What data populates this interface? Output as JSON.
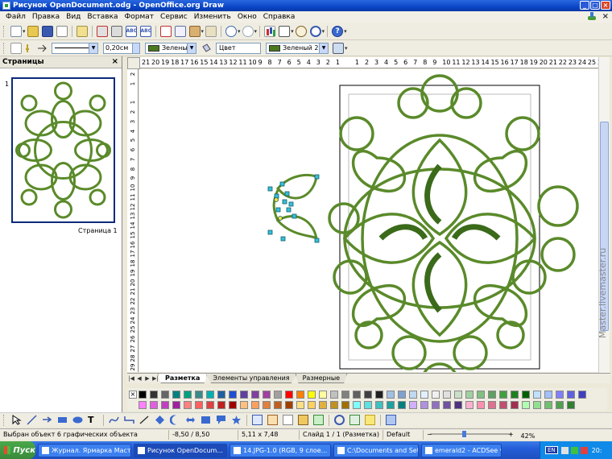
{
  "window": {
    "title": "Рисунок OpenDocument.odg - OpenOffice.org Draw"
  },
  "menu": [
    "Файл",
    "Правка",
    "Вид",
    "Вставка",
    "Формат",
    "Сервис",
    "Изменить",
    "Окно",
    "Справка"
  ],
  "toolbar2": {
    "line_width": "0,20см",
    "line_color": "Зеленый",
    "area_style": "Цвет",
    "area_color": "Зеленый 2",
    "color_hex": "#4a7a1e"
  },
  "pages_panel": {
    "title": "Страницы",
    "page_number": "1",
    "page_label": "Страница 1"
  },
  "rulers": {
    "horizontal": [
      "21",
      "20",
      "19",
      "18",
      "17",
      "16",
      "15",
      "14",
      "13",
      "12",
      "11",
      "10",
      "9",
      "8",
      "7",
      "6",
      "5",
      "4",
      "3",
      "2",
      "1",
      "",
      "1",
      "2",
      "3",
      "4",
      "5",
      "6",
      "7",
      "8",
      "9",
      "10",
      "11",
      "12",
      "13",
      "14",
      "15",
      "16",
      "17",
      "18",
      "19",
      "20",
      "21",
      "22",
      "23",
      "24",
      "25",
      "26"
    ],
    "vertical": [
      "2",
      "1",
      "",
      "1",
      "2",
      "3",
      "4",
      "5",
      "6",
      "7",
      "8",
      "9",
      "10",
      "11",
      "12",
      "13",
      "14",
      "15",
      "16",
      "17",
      "18",
      "19",
      "20",
      "21",
      "22",
      "23",
      "24",
      "25",
      "26",
      "27",
      "28",
      "29"
    ]
  },
  "tabs": [
    "Разметка",
    "Элементы управления",
    "Размерные"
  ],
  "palette_colors": [
    "#000000",
    "#333333",
    "#666666",
    "#008080",
    "#00a080",
    "#3a8a8a",
    "#00b0b0",
    "#2060a0",
    "#2050d0",
    "#6040a0",
    "#8040a0",
    "#a040a0",
    "#a0a0a0",
    "#ff0000",
    "#ff8000",
    "#ffff00",
    "#ffffa0",
    "#c0c0c0",
    "#808080",
    "#606060",
    "#404040",
    "#202020",
    "#a0c0e0",
    "#80a0d0",
    "#c0d8f0",
    "#e0f0ff",
    "#f0f0f0",
    "#e0e0e0",
    "#c8e0c8",
    "#a0d0a0",
    "#80c080",
    "#60a060",
    "#40a040",
    "#208020",
    "#006000",
    "#c0e0ff",
    "#a0c0ff",
    "#8080ff",
    "#6060e0",
    "#4040c0",
    "#ff80ff",
    "#e060e0",
    "#c040c0",
    "#a020a0",
    "#ff8080",
    "#ff6060",
    "#e04040",
    "#c02020",
    "#a00000",
    "#ffc080",
    "#ffa060",
    "#e08040",
    "#c06020",
    "#a04000",
    "#ffe080",
    "#ffd060",
    "#e0b040",
    "#c09020",
    "#a07000",
    "#80ffff",
    "#60e0e0",
    "#40c0c0",
    "#20a0a0",
    "#008080",
    "#d0b0ff",
    "#b090e0",
    "#9070c0",
    "#7050a0",
    "#503080",
    "#ffb0d0",
    "#ff90b0",
    "#e07090",
    "#c05070",
    "#a03050",
    "#b0ffb0",
    "#90e090",
    "#70c070",
    "#50a050",
    "#308030"
  ],
  "statusbar": {
    "selection": "Выбран объект 6 графических объекта",
    "position": "-8,50 / 8,50",
    "size": "5,11 x 7,48",
    "slide": "Слайд 1 / 1 (Разметка)",
    "layout": "Default",
    "zoom": "42%"
  },
  "taskbar": {
    "start": "Пуск",
    "items": [
      "Журнал. Ярмарка Маст...",
      "Рисунок OpenDocum...",
      "14.JPG-1.0 (RGB, 9 слое...",
      "C:\\Documents and Settin...",
      "emerald2 - ACDSee v3.1"
    ],
    "lang": "EN",
    "clock": "20:"
  },
  "watermark": "Master.livemaster.ru"
}
